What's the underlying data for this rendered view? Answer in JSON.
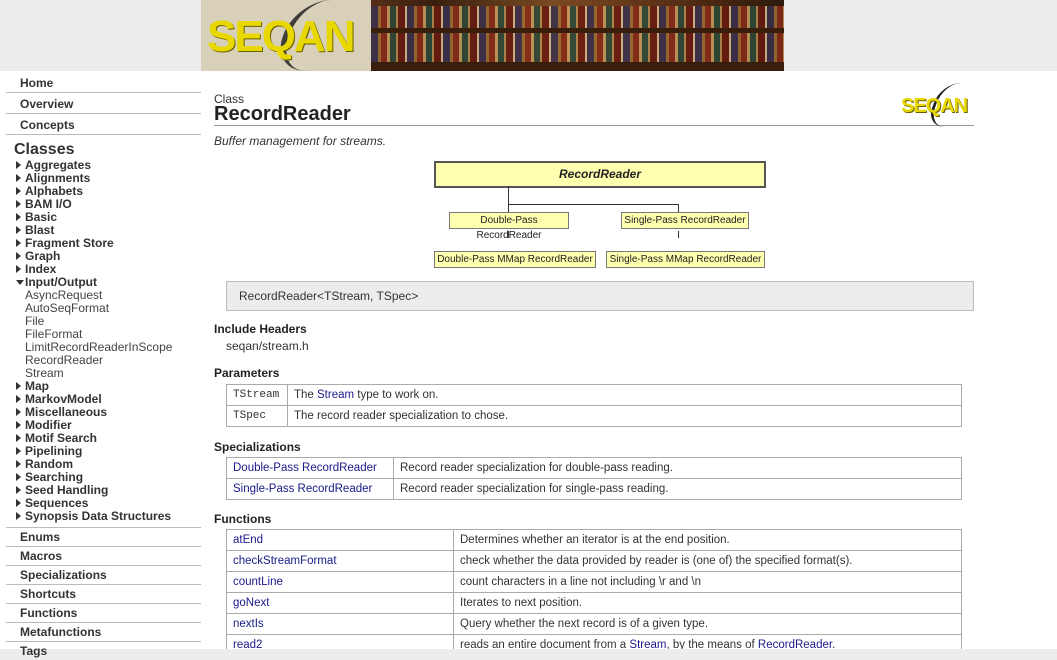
{
  "banner": {
    "logo_text": "SEQAN"
  },
  "sidebar": {
    "top": [
      "Home",
      "Overview",
      "Concepts"
    ],
    "classes_heading": "Classes",
    "classes": [
      {
        "label": "Aggregates",
        "open": false
      },
      {
        "label": "Alignments",
        "open": false
      },
      {
        "label": "Alphabets",
        "open": false
      },
      {
        "label": "BAM I/O",
        "open": false
      },
      {
        "label": "Basic",
        "open": false
      },
      {
        "label": "Blast",
        "open": false
      },
      {
        "label": "Fragment Store",
        "open": false
      },
      {
        "label": "Graph",
        "open": false
      },
      {
        "label": "Index",
        "open": false
      },
      {
        "label": "Input/Output",
        "open": true
      }
    ],
    "io_items": [
      "AsyncRequest",
      "AutoSeqFormat",
      "File",
      "FileFormat",
      "LimitRecordReaderInScope",
      "RecordReader",
      "Stream"
    ],
    "classes_after": [
      "Map",
      "MarkovModel",
      "Miscellaneous",
      "Modifier",
      "Motif Search",
      "Pipelining",
      "Random",
      "Searching",
      "Seed Handling",
      "Sequences",
      "Synopsis Data Structures"
    ],
    "sections": [
      "Enums",
      "Macros",
      "Specializations",
      "Shortcuts",
      "Functions",
      "Metafunctions",
      "Tags"
    ]
  },
  "main": {
    "kind": "Class",
    "title": "RecordReader",
    "logo_text": "SEQAN",
    "brief": "Buffer management for streams.",
    "diagram": {
      "root": "RecordReader",
      "children": [
        "Double-Pass RecordReader",
        "Single-Pass RecordReader"
      ],
      "grandchildren": [
        "Double-Pass MMap RecordReader",
        "Single-Pass MMap RecordReader"
      ]
    },
    "signature": "RecordReader<TStream, TSpec>",
    "include_heading": "Include Headers",
    "include_file": "seqan/stream.h",
    "params_heading": "Parameters",
    "params": [
      {
        "name": "TStream",
        "pre": "The ",
        "link": "Stream",
        "post": " type to work on."
      },
      {
        "name": "TSpec",
        "pre": "The record reader specialization to chose.",
        "link": "",
        "post": ""
      }
    ],
    "specs_heading": "Specializations",
    "specs": [
      {
        "name": "Double-Pass RecordReader",
        "desc": "Record reader specialization for double-pass reading."
      },
      {
        "name": "Single-Pass RecordReader",
        "desc": "Record reader specialization for single-pass reading."
      }
    ],
    "funcs_heading": "Functions",
    "funcs": [
      {
        "name": "atEnd",
        "desc": "Determines whether an iterator is at the end position."
      },
      {
        "name": "checkStreamFormat",
        "desc": "check whether the data provided by reader is (one of) the specified format(s)."
      },
      {
        "name": "countLine",
        "desc": "count characters in a line not including \\r and \\n"
      },
      {
        "name": "goNext",
        "desc": "Iterates to next position."
      },
      {
        "name": "nextIs",
        "desc": "Query whether the next record is of a given type."
      },
      {
        "name": "read2",
        "desc_pre": "reads an entire document from a ",
        "desc_link1": "Stream",
        "desc_mid": ", by the means of ",
        "desc_link2": "RecordReader",
        "desc_post": "."
      }
    ]
  }
}
